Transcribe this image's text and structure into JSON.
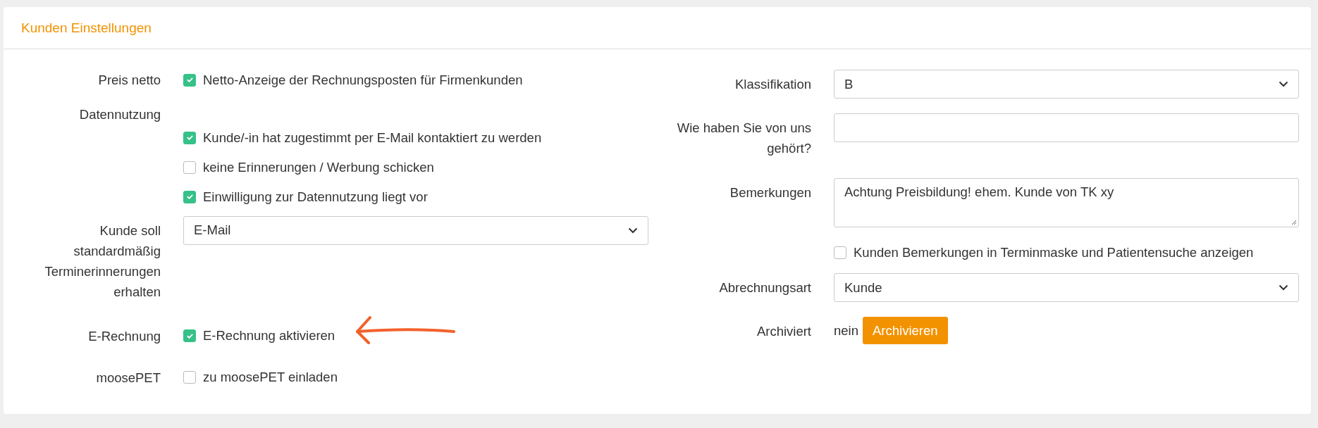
{
  "panel": {
    "title": "Kunden Einstellungen"
  },
  "left_fields": [
    {
      "kind": "checkbox",
      "label": "Preis netto",
      "options": [
        {
          "label": "Netto-Anzeige der Rechnungsposten für Firmenkunden",
          "checked": true
        }
      ]
    },
    {
      "kind": "group",
      "label": "Datennutzung",
      "options": [
        {
          "label": "Kunde/-in hat zugestimmt per E-Mail kontaktiert zu werden",
          "checked": true
        },
        {
          "label": "keine Erinnerungen / Werbung schicken",
          "checked": false
        },
        {
          "label": "Einwilligung zur Datennutzung liegt vor",
          "checked": true
        }
      ]
    },
    {
      "kind": "select",
      "label": "Kunde soll standardmäßig Terminerinnerungen erhalten",
      "value": "E-Mail"
    },
    {
      "kind": "checkbox",
      "label": "E-Rechnung",
      "annotated": true,
      "options": [
        {
          "label": "E-Rechnung aktivieren",
          "checked": true
        }
      ]
    },
    {
      "kind": "checkbox",
      "label": "moosePET",
      "options": [
        {
          "label": "zu moosePET einladen",
          "checked": false
        }
      ]
    }
  ],
  "right_fields": [
    {
      "kind": "select",
      "label": "Klassifikation",
      "value": "B"
    },
    {
      "kind": "input",
      "label": "Wie haben Sie von uns gehört?"
    },
    {
      "kind": "textarea",
      "label": "Bemerkungen",
      "value": "Achtung Preisbildung! ehem. Kunde von TK xy"
    },
    {
      "kind": "checkbox",
      "options": [
        {
          "label": "Kunden Bemerkungen in Terminmaske und Patientensuche anzeigen",
          "checked": false
        }
      ]
    },
    {
      "kind": "select",
      "label": "Abrechnungsart",
      "value": "Kunde"
    },
    {
      "kind": "status",
      "label": "Archiviert",
      "value": "nein",
      "button": "Archivieren"
    }
  ]
}
